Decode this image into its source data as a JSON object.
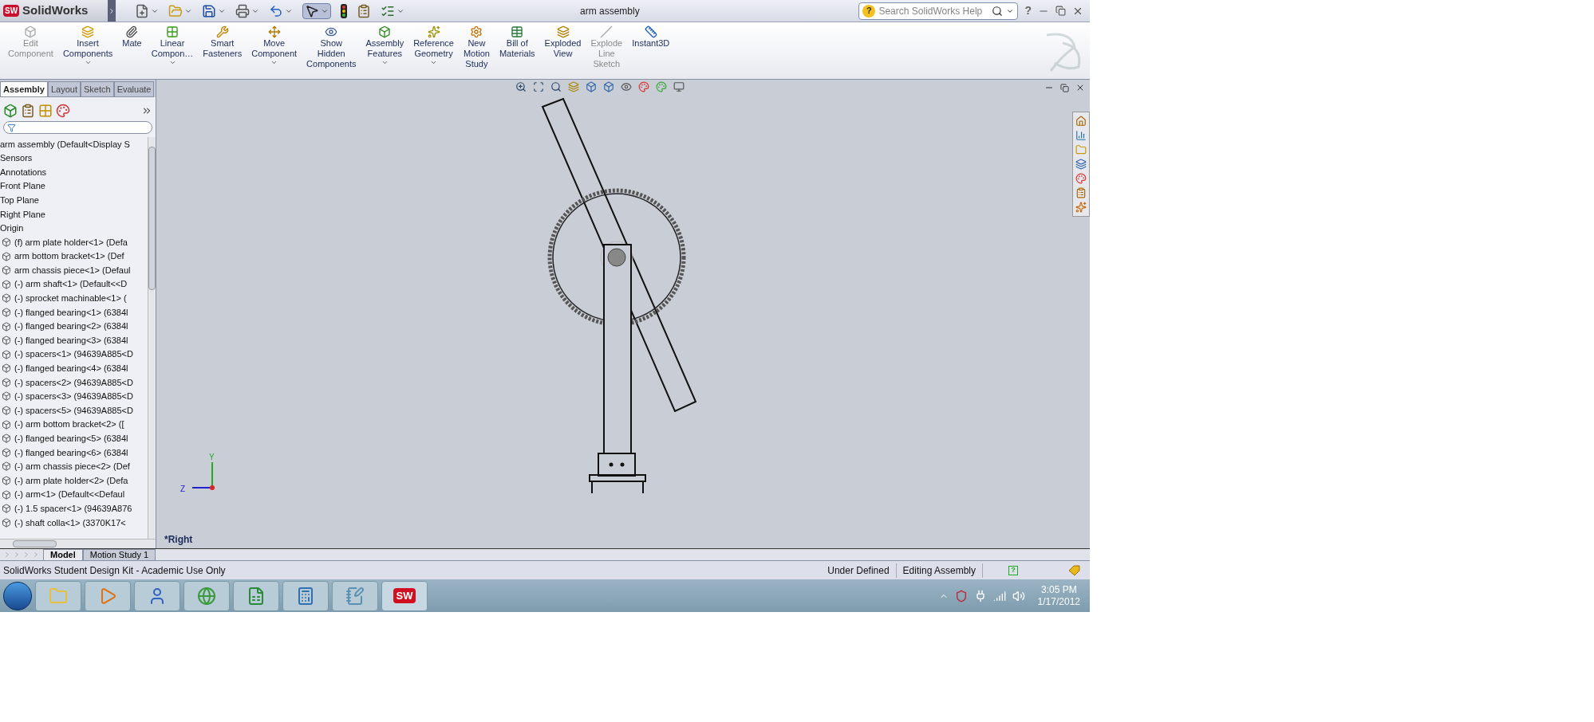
{
  "app": {
    "badge": "SW",
    "name": "SolidWorks"
  },
  "window": {
    "title": "arm assembly"
  },
  "search": {
    "placeholder": "Search SolidWorks Help"
  },
  "help": {
    "label": "?"
  },
  "commands": [
    {
      "lines": [
        "Edit",
        "Component"
      ],
      "disabled": true,
      "dropdown": false
    },
    {
      "lines": [
        "Insert",
        "Components"
      ],
      "disabled": false,
      "dropdown": true
    },
    {
      "lines": [
        "Mate"
      ],
      "disabled": false,
      "dropdown": false
    },
    {
      "lines": [
        "Linear",
        "Compon…"
      ],
      "disabled": false,
      "dropdown": true
    },
    {
      "lines": [
        "Smart",
        "Fasteners"
      ],
      "disabled": false,
      "dropdown": false
    },
    {
      "lines": [
        "Move",
        "Component"
      ],
      "disabled": false,
      "dropdown": true
    },
    {
      "lines": [
        "Show",
        "Hidden",
        "Components"
      ],
      "disabled": false,
      "dropdown": false
    },
    {
      "lines": [
        "Assembly",
        "Features"
      ],
      "disabled": false,
      "dropdown": true
    },
    {
      "lines": [
        "Reference",
        "Geometry"
      ],
      "disabled": false,
      "dropdown": true
    },
    {
      "lines": [
        "New",
        "Motion",
        "Study"
      ],
      "disabled": false,
      "dropdown": false
    },
    {
      "lines": [
        "Bill of",
        "Materials"
      ],
      "disabled": false,
      "dropdown": false
    },
    {
      "lines": [
        "Exploded",
        "View"
      ],
      "disabled": false,
      "dropdown": false
    },
    {
      "lines": [
        "Explode",
        "Line",
        "Sketch"
      ],
      "disabled": true,
      "dropdown": false
    },
    {
      "lines": [
        "Instant3D"
      ],
      "disabled": false,
      "dropdown": false
    }
  ],
  "tabs": [
    {
      "label": "Assembly",
      "selected": true
    },
    {
      "label": "Layout",
      "selected": false
    },
    {
      "label": "Sketch",
      "selected": false
    },
    {
      "label": "Evaluate",
      "selected": false
    }
  ],
  "tree": [
    {
      "kind": "root",
      "label": "arm assembly  (Default<Display S"
    },
    {
      "kind": "folder",
      "label": "Sensors"
    },
    {
      "kind": "folder",
      "label": "Annotations"
    },
    {
      "kind": "folder",
      "label": "Front Plane"
    },
    {
      "kind": "folder",
      "label": "Top Plane"
    },
    {
      "kind": "folder",
      "label": "Right Plane"
    },
    {
      "kind": "folder",
      "label": "Origin"
    },
    {
      "kind": "part",
      "label": "(f) arm plate holder<1> (Defa"
    },
    {
      "kind": "part",
      "label": "arm bottom bracket<1> (Def"
    },
    {
      "kind": "part",
      "label": "arm chassis piece<1> (Defaul"
    },
    {
      "kind": "part",
      "label": "(-) arm shaft<1> (Default<<D"
    },
    {
      "kind": "part",
      "label": "(-) sprocket machinable<1> ("
    },
    {
      "kind": "part",
      "label": "(-) flanged bearing<1> (6384l"
    },
    {
      "kind": "part",
      "label": "(-) flanged bearing<2> (6384l"
    },
    {
      "kind": "part",
      "label": "(-) flanged bearing<3> (6384l"
    },
    {
      "kind": "part",
      "label": "(-) spacers<1> (94639A885<D"
    },
    {
      "kind": "part",
      "label": "(-) flanged bearing<4> (6384l"
    },
    {
      "kind": "part",
      "label": "(-) spacers<2> (94639A885<D"
    },
    {
      "kind": "part",
      "label": "(-) spacers<3> (94639A885<D"
    },
    {
      "kind": "part",
      "label": "(-) spacers<5> (94639A885<D"
    },
    {
      "kind": "part",
      "label": "(-) arm bottom bracket<2> (["
    },
    {
      "kind": "part",
      "label": "(-) flanged bearing<5> (6384l"
    },
    {
      "kind": "part",
      "label": "(-) flanged bearing<6> (6384l"
    },
    {
      "kind": "part",
      "label": "(-) arm chassis piece<2> (Def"
    },
    {
      "kind": "part",
      "label": "(-) arm plate holder<2> (Defa"
    },
    {
      "kind": "part",
      "label": "(-) arm<1> (Default<<Defaul"
    },
    {
      "kind": "part",
      "label": "(-) 1.5 spacer<1> (94639A876"
    },
    {
      "kind": "part",
      "label": "(-) shaft colla<1> (3370K17<"
    }
  ],
  "viewport": {
    "view_name": "*Right",
    "axis_y": "Y",
    "axis_z": "Z"
  },
  "bottom_tabs": [
    {
      "label": "Model",
      "selected": true
    },
    {
      "label": "Motion Study 1",
      "selected": false
    }
  ],
  "status_bar": {
    "message": "SolidWorks Student Design Kit - Academic Use Only",
    "state": "Under Defined",
    "mode": "Editing Assembly",
    "help": "?"
  },
  "taskbar": {
    "sw_badge": "SW",
    "time": "3:05 PM",
    "date": "1/17/2012"
  }
}
